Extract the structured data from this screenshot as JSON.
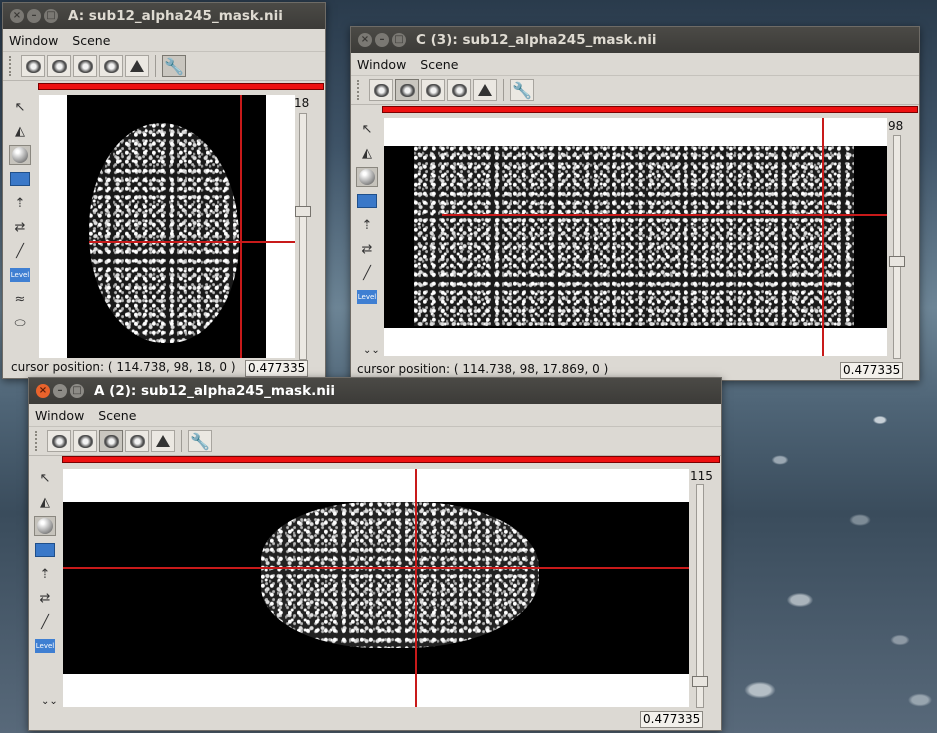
{
  "windows": {
    "a1": {
      "title": "A: sub12_alpha245_mask.nii",
      "menu": [
        "Window",
        "Scene"
      ],
      "slice_number": "18",
      "status": "cursor position: ( 114.738, 98, 18, 0 )",
      "value": "0.477335",
      "slider_fraction": 0.37
    },
    "c3": {
      "title": "C (3): sub12_alpha245_mask.nii",
      "menu": [
        "Window",
        "Scene"
      ],
      "slice_number": "98",
      "status": "cursor position: ( 114.738, 98, 17.869, 0 )",
      "value": "0.477335",
      "slider_fraction": 0.6
    },
    "a2": {
      "title": "A (2): sub12_alpha245_mask.nii",
      "menu": [
        "Window",
        "Scene"
      ],
      "slice_number": "115",
      "value": "0.477335",
      "slider_fraction": 0.9
    }
  },
  "icons": {
    "titlebar": [
      "close-icon",
      "minimize-icon",
      "maximize-icon"
    ],
    "toolbar": [
      "brain-sagittal-icon",
      "brain-coronal-icon",
      "brain-axial-icon",
      "brain-multi-icon",
      "surface-icon",
      "wrench-icon"
    ],
    "left_tools": [
      "pointer-icon",
      "plane-icon",
      "sphere-icon",
      "rotate-icon",
      "axes-icon",
      "transform-icon",
      "brush-icon",
      "level-icon",
      "segment-icon",
      "label-icon"
    ]
  },
  "colors": {
    "crosshair": "#c81a1a",
    "redbar": "#ee1111",
    "close_button": "#e9632c"
  }
}
